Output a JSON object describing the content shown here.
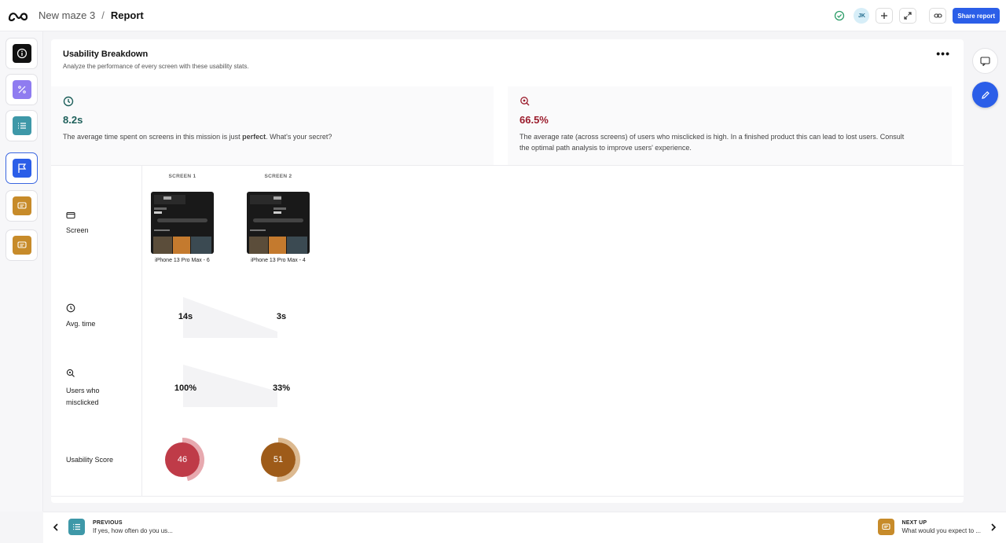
{
  "header": {
    "project": "New maze 3",
    "separator": "/",
    "page": "Report",
    "avatar_initials": "JK",
    "share_label": "Share report"
  },
  "rail": {
    "items": [
      {
        "icon": "info-icon",
        "color": "#111111"
      },
      {
        "icon": "opinion-scale-icon",
        "color": "#8f7cf0"
      },
      {
        "icon": "list-icon",
        "color": "#3e98a8"
      },
      {
        "icon": "flag-icon",
        "color": "#2b5ee8",
        "active": true
      },
      {
        "icon": "comment-icon",
        "color": "#c78b2a"
      },
      {
        "icon": "comment-icon",
        "color": "#c78b2a"
      }
    ]
  },
  "card": {
    "title": "Usability Breakdown",
    "subtitle": "Analyze the performance of every screen with these usability stats."
  },
  "stats": {
    "time": {
      "value": "8.2s",
      "desc_pre": "The average time spent on screens in this mission is just ",
      "desc_bold": "perfect",
      "desc_post": ". What's your secret?",
      "color": "#1d5f5a"
    },
    "misclick": {
      "value": "66.5%",
      "line1": "The average rate (across screens) of users who misclicked is high. In a finished product this can lead to lost users. Consult",
      "line2": "the optimal path analysis to improve users' experience.",
      "color": "#9b1c2c"
    }
  },
  "rows": {
    "screen": "Screen",
    "avg_time": "Avg. time",
    "misclick_1": "Users who",
    "misclick_2": "misclicked",
    "score": "Usability Score"
  },
  "screens": [
    {
      "header": "SCREEN 1",
      "name": "iPhone 13 Pro Max - 6",
      "time": "14s",
      "misclick": "100%",
      "score": "46",
      "score_fraction": 0.46,
      "score_color": "#bf3b48",
      "ring_color": "#e7a9af"
    },
    {
      "header": "SCREEN 2",
      "name": "iPhone 13 Pro Max - 4",
      "time": "3s",
      "misclick": "33%",
      "score": "51",
      "score_fraction": 0.51,
      "score_color": "#9e5b19",
      "ring_color": "#dcb990"
    }
  ],
  "footer": {
    "prev_key": "PREVIOUS",
    "prev_text": "If yes, how often do you us...",
    "next_key": "NEXT UP",
    "next_text": "What would you expect to ..."
  }
}
